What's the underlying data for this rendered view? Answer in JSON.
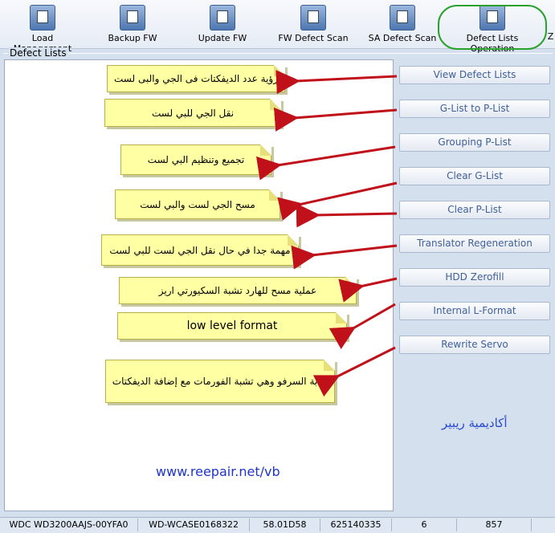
{
  "toolbar": {
    "items": [
      {
        "label": "Load Management"
      },
      {
        "label": "Backup FW"
      },
      {
        "label": "Update FW"
      },
      {
        "label": "FW Defect Scan"
      },
      {
        "label": "SA Defect Scan"
      },
      {
        "label": "Defect Lists Operation"
      },
      {
        "label": "Z"
      }
    ]
  },
  "group": {
    "title": "Defect Lists"
  },
  "buttons": [
    "View Defect Lists",
    "G-List to P-List",
    "Grouping P-List",
    "Clear G-List",
    "Clear P-List",
    "Translator Regeneration",
    "HDD Zerofill",
    "Internal L-Format",
    "Rewrite Servo"
  ],
  "notes": [
    "رؤية عدد الديفكتات فى الجي والبى لست",
    "نقل الجي للبي لست",
    "تجميع وتنظيم البي لست",
    "مسح الجي لست والبي لست",
    "مهمة جدا في حال نقل الجي لست للبي لست",
    "عملية مسح للهارد تشبة السكيورتي اريز",
    "low level format",
    "كتابة السرفو وهي تشبة الفورمات مع إضافة الديفكتات"
  ],
  "watermark": "www.reepair.net/vb",
  "brand": "أكاديمية ريبير",
  "status": {
    "model": "WDC WD3200AAJS-00YFA0",
    "serial": "WD-WCASE0168322",
    "firmware": "58.01D58",
    "lba": "625140335",
    "heads": "6",
    "value": "857"
  },
  "colors": {
    "accent": "#2aa12e",
    "arrow": "#c0101a",
    "note": "#ffffa4"
  }
}
